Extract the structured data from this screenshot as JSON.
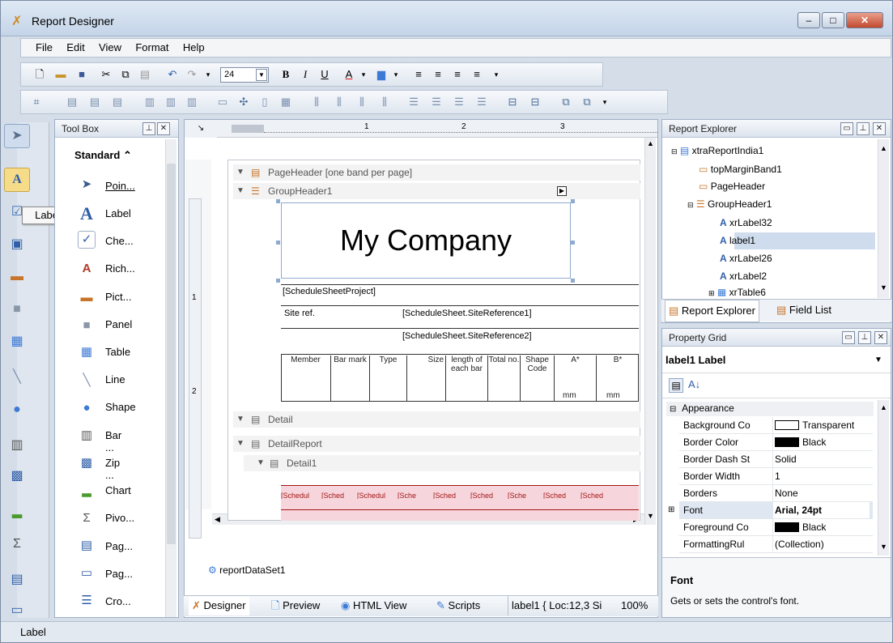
{
  "window": {
    "title": "Report Designer",
    "status": "Label"
  },
  "menu": [
    "File",
    "Edit",
    "View",
    "Format",
    "Help"
  ],
  "format_toolbar": {
    "font_size": "24"
  },
  "toolbox": {
    "title": "Tool Box",
    "category": "Standard",
    "tooltip": "Label",
    "items": [
      "Poin...",
      "Label",
      "Che...",
      "Rich...",
      "Pict...",
      "Panel",
      "Table",
      "Line",
      "Shape",
      "Bar ...",
      "Zip ...",
      "Chart",
      "Pivo...",
      "Pag...",
      "Pag...",
      "Cro..."
    ]
  },
  "designer": {
    "bands": {
      "page_header": "PageHeader [one band per page]",
      "group_header": "GroupHeader1",
      "detail": "Detail",
      "detail_report": "DetailReport",
      "detail1": "Detail1"
    },
    "ruler_ticks": [
      "1",
      "2",
      "3"
    ],
    "vruler_ticks": [
      "1",
      "2"
    ],
    "company_label": "My Company",
    "project_field": "[ScheduleSheetProject]",
    "site_ref_label": "Site ref.",
    "site_ref1": "[ScheduleSheet.SiteReference1]",
    "site_ref2": "[ScheduleSheet.SiteReference2]",
    "columns": [
      "Member",
      "Bar mark",
      "Type",
      "Size",
      "length of each bar",
      "Total no.",
      "Shape Code",
      "A*",
      "B*"
    ],
    "column_units": [
      "",
      "",
      "",
      "",
      "",
      "",
      "",
      "mm",
      "mm"
    ],
    "detail_cells": [
      "[Schedul",
      "[Sched",
      "[Schedul",
      "[Sche",
      "[Sched",
      "[Sched",
      "[Sche",
      "[Sched",
      "[Sched"
    ],
    "dataset": "reportDataSet1"
  },
  "bottom_tabs": {
    "designer": "Designer",
    "preview": "Preview",
    "html_view": "HTML View",
    "scripts": "Scripts",
    "location": "label1 { Loc:12,3 Si",
    "zoom": "100%"
  },
  "report_explorer": {
    "title": "Report Explorer",
    "tabs": [
      "Report Explorer",
      "Field List"
    ],
    "nodes": [
      "xtraReportIndia1",
      "topMarginBand1",
      "PageHeader",
      "GroupHeader1",
      "xrLabel32",
      "label1",
      "xrLabel26",
      "xrLabel2",
      "xrTable6"
    ]
  },
  "property_grid": {
    "title": "Property Grid",
    "selected": "label1  Label",
    "category": "Appearance",
    "rows": [
      {
        "name": "Background Co",
        "value": "Transparent"
      },
      {
        "name": "Border Color",
        "value": "Black"
      },
      {
        "name": "Border Dash St",
        "value": "Solid"
      },
      {
        "name": "Border Width",
        "value": "1"
      },
      {
        "name": "Borders",
        "value": "None"
      },
      {
        "name": "Font",
        "value": "Arial, 24pt"
      },
      {
        "name": "Foreground Co",
        "value": "Black"
      },
      {
        "name": "FormattingRul",
        "value": "(Collection)"
      }
    ],
    "desc_title": "Font",
    "desc_text": "Gets or sets the control's font."
  },
  "colors": {
    "selection": "#cfdcee",
    "detail_band": "#f6d6dc",
    "detail_text": "#a41414"
  }
}
